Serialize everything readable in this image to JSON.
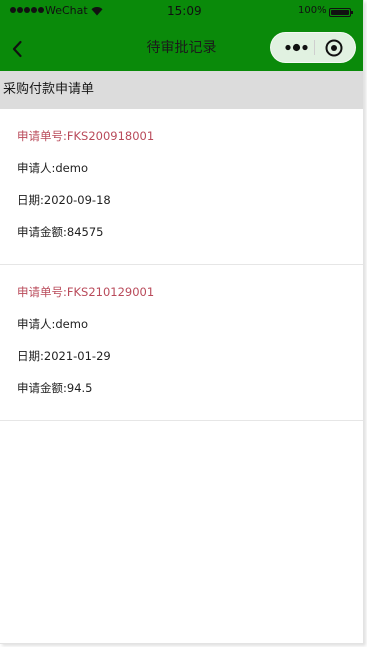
{
  "colors": {
    "header_bg": "#0a8a0a",
    "section_bg": "#dcdcdc",
    "number_text": "#b94a5a"
  },
  "status_bar": {
    "carrier": "WeChat",
    "time": "15:09",
    "battery": "100%"
  },
  "nav": {
    "title": "待审批记录",
    "back_icon": "chevron-left-icon",
    "more_icon": "more-dots-icon",
    "close_icon": "target-circle-icon"
  },
  "section": {
    "title": "采购付款申请单"
  },
  "records": [
    {
      "number": "申请单号:FKS200918001",
      "applicant": "申请人:demo",
      "date": "日期:2020-09-18",
      "amount": "申请金额:84575"
    },
    {
      "number": "申请单号:FKS210129001",
      "applicant": "申请人:demo",
      "date": "日期:2021-01-29",
      "amount": "申请金额:94.5"
    }
  ]
}
